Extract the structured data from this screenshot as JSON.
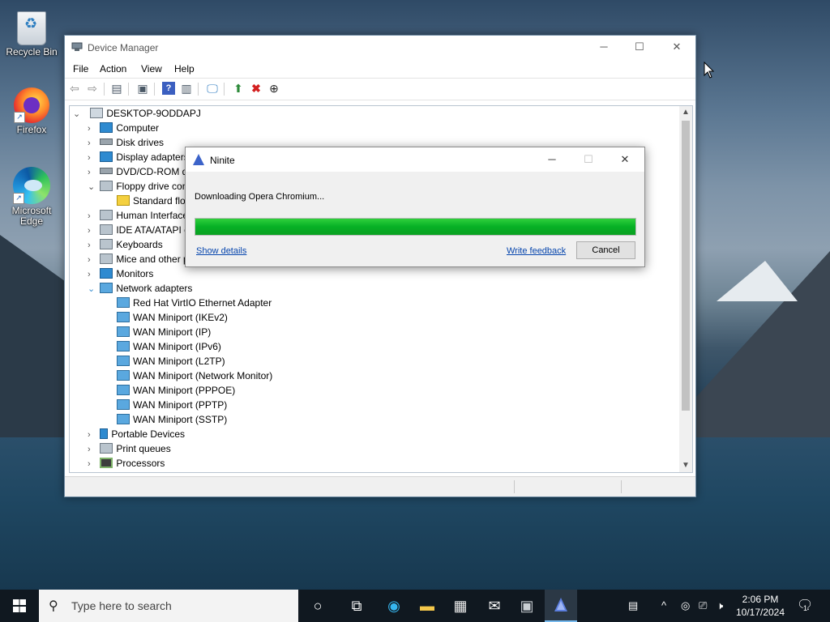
{
  "desktop": {
    "icons": [
      {
        "label": "Recycle Bin"
      },
      {
        "label": "Firefox"
      },
      {
        "label": "Microsoft Edge"
      }
    ]
  },
  "device_manager": {
    "title": "Device Manager",
    "menu": [
      "File",
      "Action",
      "View",
      "Help"
    ],
    "tree": {
      "root": "DESKTOP-9ODDAPJ",
      "items": [
        {
          "label": "Computer"
        },
        {
          "label": "Disk drives"
        },
        {
          "label": "Display adapters"
        },
        {
          "label": "DVD/CD-ROM drives"
        },
        {
          "label": "Floppy drive controllers"
        },
        {
          "label": "Standard floppy disk controller"
        },
        {
          "label": "Human Interface Devices"
        },
        {
          "label": "IDE ATA/ATAPI controllers"
        },
        {
          "label": "Keyboards"
        },
        {
          "label": "Mice and other pointing devices"
        },
        {
          "label": "Monitors"
        },
        {
          "label": "Network adapters"
        },
        {
          "label": "Red Hat VirtIO Ethernet Adapter"
        },
        {
          "label": "WAN Miniport (IKEv2)"
        },
        {
          "label": "WAN Miniport (IP)"
        },
        {
          "label": "WAN Miniport (IPv6)"
        },
        {
          "label": "WAN Miniport (L2TP)"
        },
        {
          "label": "WAN Miniport (Network Monitor)"
        },
        {
          "label": "WAN Miniport (PPPOE)"
        },
        {
          "label": "WAN Miniport (PPTP)"
        },
        {
          "label": "WAN Miniport (SSTP)"
        },
        {
          "label": "Portable Devices"
        },
        {
          "label": "Print queues"
        },
        {
          "label": "Processors"
        }
      ]
    }
  },
  "ninite": {
    "title": "Ninite",
    "message": "Downloading Opera Chromium...",
    "progress": 1.0,
    "show_details": "Show details",
    "write_feedback": "Write feedback",
    "cancel": "Cancel"
  },
  "taskbar": {
    "search_placeholder": "Type here to search",
    "time": "2:06 PM",
    "date": "10/17/2024",
    "notification_count": "1"
  }
}
